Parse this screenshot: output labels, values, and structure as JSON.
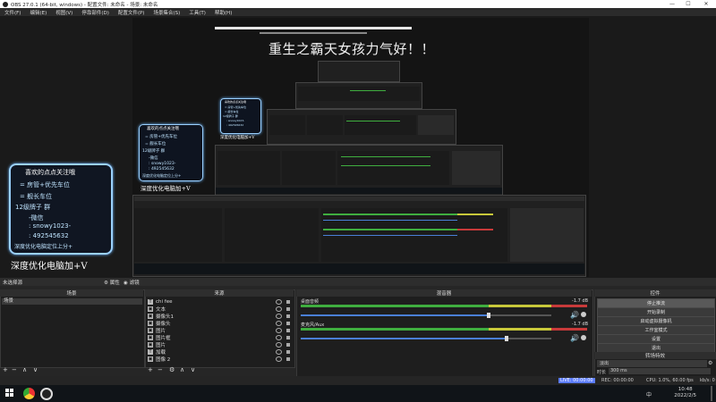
{
  "window": {
    "title": "OBS 27.0.1 (64-bit, windows) - 配置文件: 未命名 - 场景: 未命名",
    "controls": [
      "—",
      "☐",
      "✕"
    ]
  },
  "menu": [
    "文件(F)",
    "编辑(E)",
    "视图(V)",
    "停靠部件(D)",
    "配置文件(P)",
    "场景集合(S)",
    "工具(T)",
    "帮助(H)"
  ],
  "preview": {
    "overlay_text": "重生之霸天女孩力气好",
    "overlay_suffix": "！！",
    "promo": {
      "title": "喜欢的点点关注哦",
      "lines": [
        "= 房管+优先车位",
        "= 舰长车位",
        "12级牌子 群",
        "-微信",
        ": snowy1023-",
        ": 492545632",
        "深度优化电脑定位上分+"
      ],
      "caption": "深度优化电脑加+V"
    }
  },
  "docks": {
    "top_label": "未选择源",
    "props_label": "属性",
    "filters_label": "滤镜",
    "scenes": {
      "title": "场景",
      "items": [
        "场景"
      ]
    },
    "sources": {
      "title": "来源",
      "items": [
        {
          "icon": "T",
          "name": "chi fee"
        },
        {
          "icon": "▣",
          "name": "文本"
        },
        {
          "icon": "▣",
          "name": "摄像头1"
        },
        {
          "icon": "▣",
          "name": "摄像头"
        },
        {
          "icon": "▣",
          "name": "图片"
        },
        {
          "icon": "▣",
          "name": "图片框"
        },
        {
          "icon": "▣",
          "name": "图片"
        },
        {
          "icon": "T",
          "name": "加载"
        },
        {
          "icon": "▣",
          "name": "图像 2"
        }
      ]
    },
    "mixer": {
      "title": "混音器",
      "tracks": [
        {
          "name": "桌面音频",
          "db": "-1.7 dB",
          "level": 0.75
        },
        {
          "name": "麦克风/Aux",
          "db": "-1.7 dB",
          "level": 0.82
        }
      ]
    },
    "controls": {
      "title": "控件",
      "buttons": [
        "停止推流",
        "开始录制",
        "启动虚拟摄像机",
        "工作室模式",
        "设置",
        "退出"
      ]
    },
    "transitions": {
      "title": "转场特效",
      "type": "淡出",
      "duration_label": "时长",
      "duration": "300 ms"
    }
  },
  "status": {
    "live": "LIVE: 00:00:00",
    "rec": "REC: 00:00:00",
    "cpu": "CPU: 1.0%, 60.00 fps",
    "kbps": "kb/s: 0"
  },
  "taskbar": {
    "time": "10:48",
    "date": "2022/2/5",
    "lang": "中"
  },
  "colors": {
    "meter_green": "#3fae3f",
    "meter_yellow": "#c8c83a",
    "meter_red": "#c83a3a",
    "volume_blue": "#4a7fd6",
    "live_badge": "#5b7cff"
  }
}
